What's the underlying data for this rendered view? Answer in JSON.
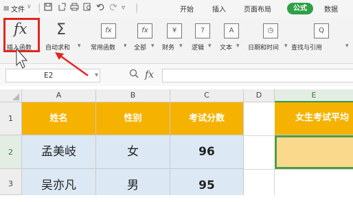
{
  "menu": {
    "hamburger": "≡",
    "file_label": "文件",
    "file_caret": "∨",
    "tabs": [
      "开始",
      "插入",
      "页面布局",
      "公式",
      "数据"
    ],
    "active_tab": "公式"
  },
  "ribbon": {
    "insert_function": {
      "icon": "fx",
      "label": "插入函数"
    },
    "autosum": {
      "icon": "Σ",
      "label": "自动求和"
    },
    "groups": [
      {
        "icon": "fx",
        "label": "常用函数"
      },
      {
        "icon": "fx",
        "label": "全部"
      },
      {
        "icon": "¥",
        "label": "财务"
      },
      {
        "icon": "?",
        "label": "逻辑"
      },
      {
        "icon": "A",
        "label": "文本"
      },
      {
        "icon": "◷",
        "label": "日期和时间"
      },
      {
        "icon": "Q",
        "label": "查找与引用"
      }
    ],
    "dropdown_caret": "▾"
  },
  "formula_bar": {
    "name_box": "E2",
    "fx_label": "fx",
    "formula": ""
  },
  "columns": [
    "A",
    "B",
    "C",
    "D",
    "E"
  ],
  "rows": [
    "1",
    "2",
    "3"
  ],
  "table": {
    "headers": [
      "姓名",
      "性别",
      "考试分数"
    ],
    "rows": [
      [
        "孟美岐",
        "女",
        "96"
      ],
      [
        "吴亦凡",
        "男",
        "95"
      ]
    ]
  },
  "e1_label": "女生考试平均",
  "colors": {
    "accent_green": "#2fa045",
    "header_orange": "#f5b200",
    "body_blue": "#dce9f5",
    "highlight_red": "#e0261f"
  }
}
